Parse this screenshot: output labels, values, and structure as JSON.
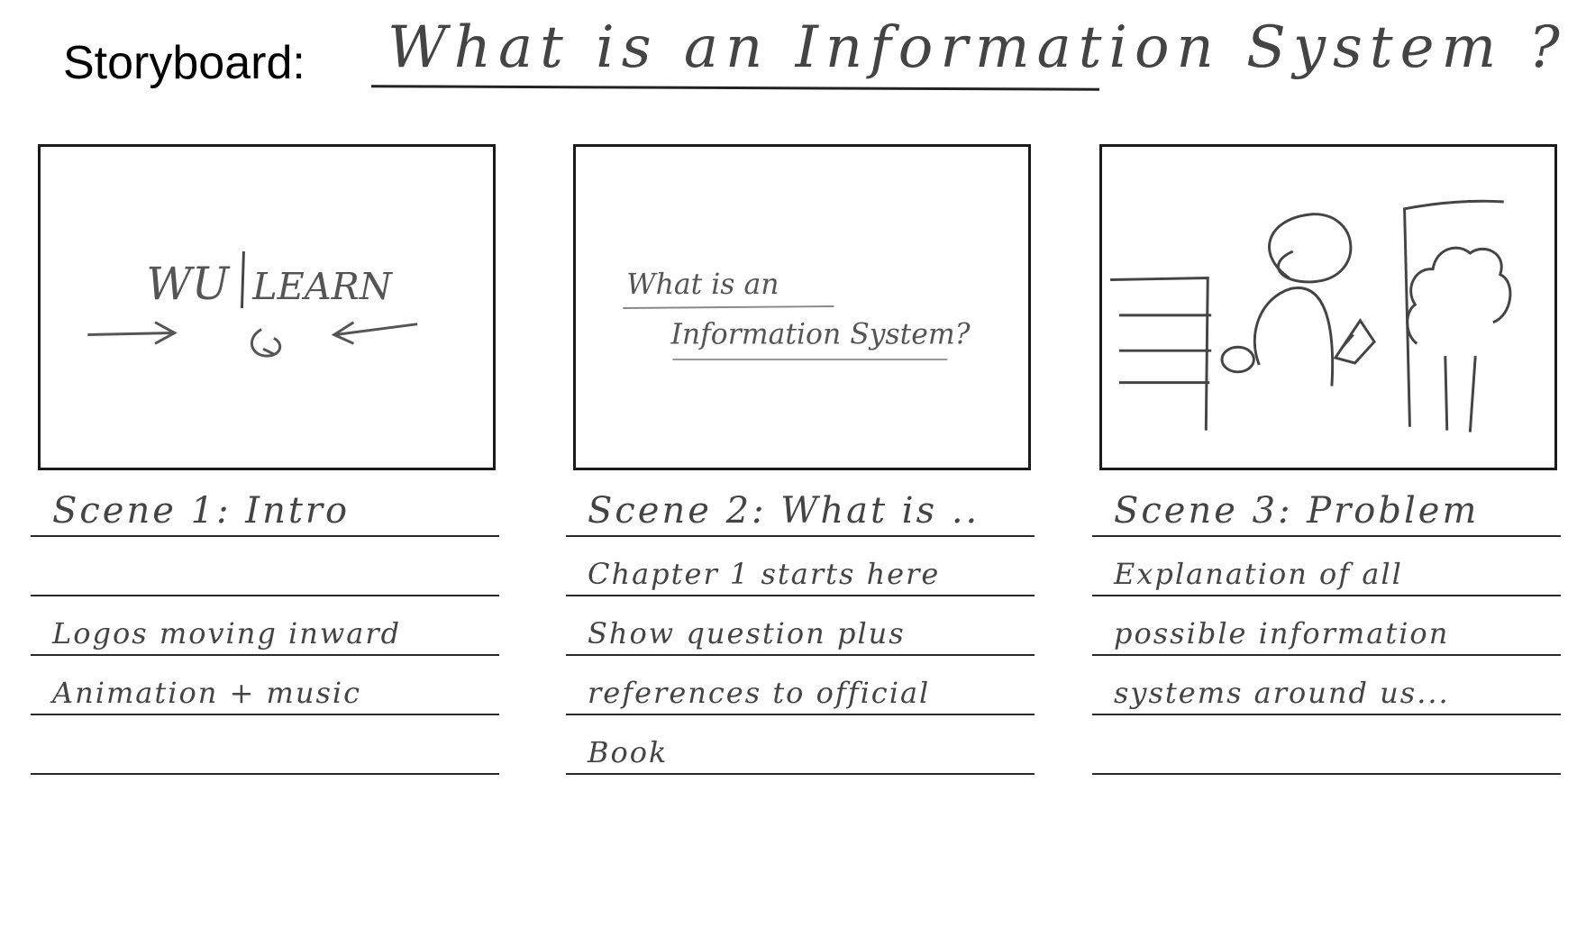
{
  "header": {
    "label": "Storyboard:",
    "title": "What is an Information System ?"
  },
  "scenes": [
    {
      "sketch": {
        "logo_left": "WU",
        "logo_right": "LEARN"
      },
      "lines": [
        "Scene 1: Intro",
        "",
        "Logos moving inward",
        "Animation + music",
        ""
      ]
    },
    {
      "sketch": {
        "question_line1": "What is an",
        "question_line2": "Information System?"
      },
      "lines": [
        "Scene 2: What is ..",
        "Chapter 1 starts here",
        "Show question plus",
        "references to official",
        "Book"
      ]
    },
    {
      "sketch": {},
      "lines": [
        "Scene 3: Problem",
        "Explanation of all",
        "possible information",
        "systems around us...",
        ""
      ]
    }
  ]
}
